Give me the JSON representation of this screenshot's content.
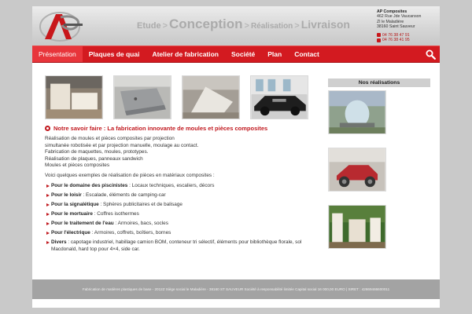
{
  "header": {
    "tagline": {
      "step1": "Etude",
      "step2": "Conception",
      "step3": "Réalisation",
      "step4": "Livraison",
      "separator": ">"
    },
    "contact": {
      "company": "AP Composites",
      "address1": "462 Rue Jde Vaucanson",
      "address2": "ZI le Maladière",
      "city": "38160 Saint Sauveur",
      "phone": "04 76 38 47 91",
      "fax": "04 76 38 41 95"
    }
  },
  "nav": {
    "items": [
      {
        "label": "Présentation",
        "active": true
      },
      {
        "label": "Plaques de quai",
        "active": false
      },
      {
        "label": "Atelier de fabrication",
        "active": false
      },
      {
        "label": "Société",
        "active": false
      },
      {
        "label": "Plan",
        "active": false
      },
      {
        "label": "Contact",
        "active": false
      }
    ],
    "search_icon": "search-icon"
  },
  "main": {
    "section_title": "Notre savoir faire : La fabrication innovante de moules et pièces composites",
    "intro_lines": [
      "Réalisation de moules et pièces composites par projection",
      "simultanée robotisée et par projection manuelle, moulage au contact.",
      "Fabrication de maquettes, moules, prototypes.",
      "Réalisation de plaques, panneaux sandwich",
      "Moules et pièces composites"
    ],
    "examples_intro": "Voici quelques exemples de réalisation de pièces en matériaux composites :",
    "domains": [
      {
        "label": "Pour le domaine des piscinistes",
        "detail": " : Locaux techniques, escaliers, décors"
      },
      {
        "label": "Pour le loisir",
        "detail": " : Escalade, éléments de camping-car"
      },
      {
        "label": "Pour la signalétique",
        "detail": " : Sphères publicitaires et de balisage"
      },
      {
        "label": "Pour le mortuaire",
        "detail": " : Coffres isothermes"
      },
      {
        "label": "Pour le traitement de l'eau",
        "detail": " : Armoires, bacs, socles"
      },
      {
        "label": "Pour l'électrique",
        "detail": " : Armoires, coffrets, boîtiers, bornes"
      },
      {
        "label": "Divers",
        "detail": " : capotage industriel, habillage camion BOM, conteneur tri sélectif, éléments pour bibliothèque florale, sol Macdonald, hard top pour 4×4, side car."
      }
    ]
  },
  "sidebar": {
    "title": "Nos réalisations"
  },
  "footer": {
    "text": "Fabrication de matières plastiques de base - 2012Z Siège social le Maladière - 38160 ST SAUVEUR Société à responsabilité limitée Capital social 16 000,00 EURO | SIRET : 42869466600011"
  },
  "colors": {
    "brand_red": "#d31a20",
    "accent_red": "#c1191f",
    "footer_gray": "#a3a3a3"
  }
}
